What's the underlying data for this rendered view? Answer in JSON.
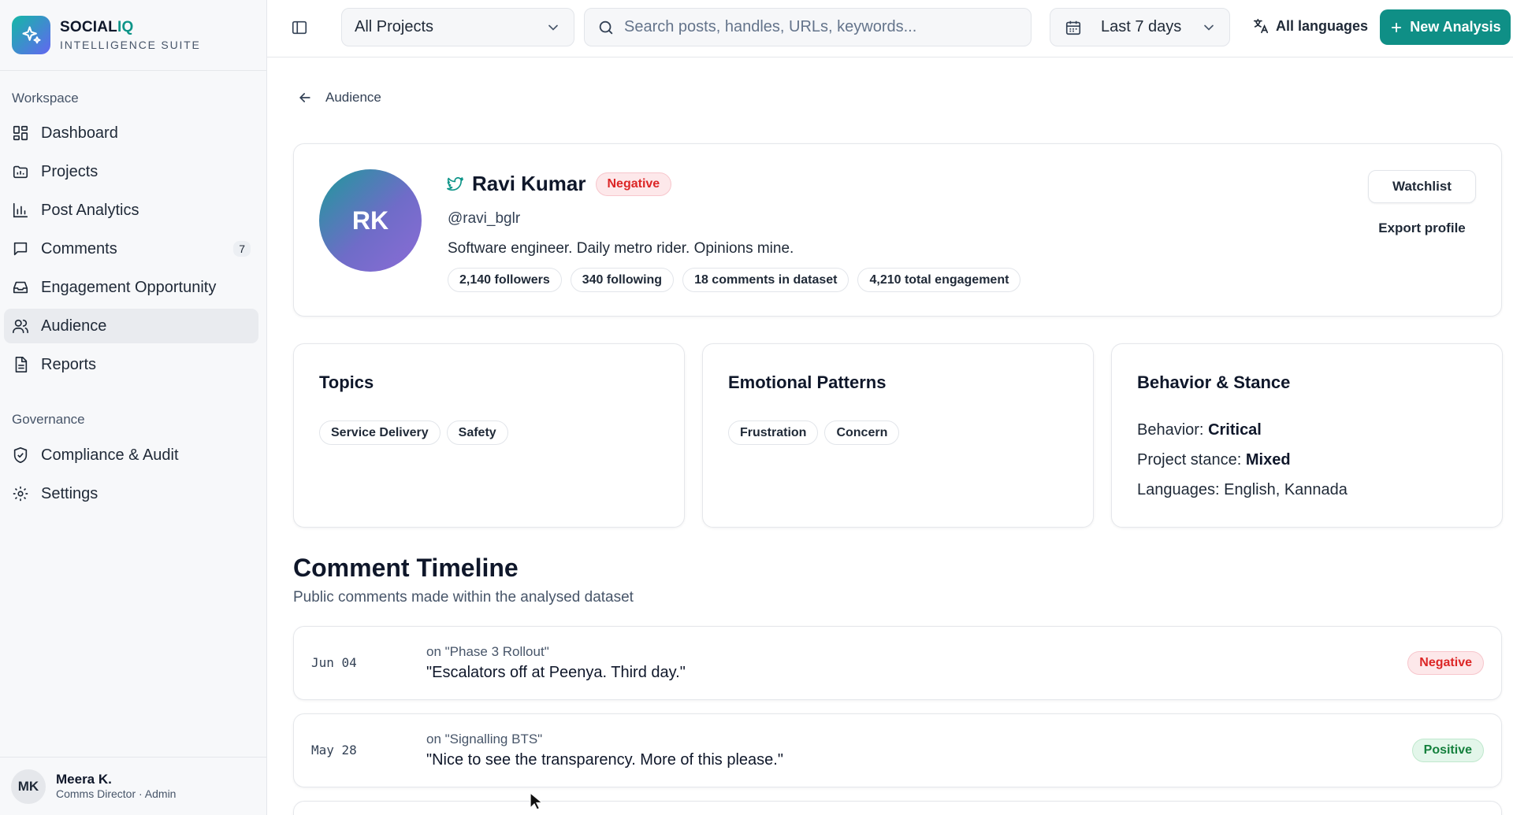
{
  "brand": {
    "name_part1": "SOCIAL",
    "name_part2": "IQ",
    "subtitle": "INTELLIGENCE SUITE"
  },
  "sidebar": {
    "workspace_heading": "Workspace",
    "workspace_items": [
      {
        "label": "Dashboard",
        "icon": "dashboard-icon"
      },
      {
        "label": "Projects",
        "icon": "folder-icon"
      },
      {
        "label": "Post Analytics",
        "icon": "bar-chart-icon"
      },
      {
        "label": "Comments",
        "icon": "comment-icon",
        "badge": "7"
      },
      {
        "label": "Engagement Opportunity",
        "icon": "inbox-icon"
      },
      {
        "label": "Audience",
        "icon": "users-icon",
        "active": true
      },
      {
        "label": "Reports",
        "icon": "report-icon"
      }
    ],
    "governance_heading": "Governance",
    "governance_items": [
      {
        "label": "Compliance & Audit",
        "icon": "shield-check-icon"
      },
      {
        "label": "Settings",
        "icon": "gear-icon"
      }
    ],
    "user": {
      "initials": "MK",
      "name": "Meera K.",
      "role": "Comms Director · Admin"
    }
  },
  "topbar": {
    "project_select": "All Projects",
    "search_placeholder": "Search posts, handles, URLs, keywords...",
    "date_range": "Last 7 days",
    "languages": "All languages",
    "new_analysis": "New Analysis"
  },
  "breadcrumb": {
    "label": "Audience"
  },
  "profile": {
    "initials": "RK",
    "name": "Ravi Kumar",
    "sentiment": "Negative",
    "handle": "@ravi_bglr",
    "bio": "Software engineer. Daily metro rider. Opinions mine.",
    "stats": [
      "2,140 followers",
      "340 following",
      "18 comments in dataset",
      "4,210 total engagement"
    ],
    "watchlist_label": "Watchlist",
    "export_label": "Export profile"
  },
  "topics": {
    "title": "Topics",
    "items": [
      "Service Delivery",
      "Safety"
    ]
  },
  "emotions": {
    "title": "Emotional Patterns",
    "items": [
      "Frustration",
      "Concern"
    ]
  },
  "behavior": {
    "title": "Behavior & Stance",
    "behavior_label": "Behavior:",
    "behavior_value": "Critical",
    "stance_label": "Project stance:",
    "stance_value": "Mixed",
    "languages_label": "Languages:",
    "languages_value": "English, Kannada"
  },
  "timeline": {
    "title": "Comment Timeline",
    "subtitle": "Public comments made within the analysed dataset",
    "items": [
      {
        "date": "Jun 04",
        "on": "on \"Phase 3 Rollout\"",
        "text": "\"Escalators off at Peenya. Third day.\"",
        "sentiment": "Negative"
      },
      {
        "date": "May 28",
        "on": "on \"Signalling BTS\"",
        "text": "\"Nice to see the transparency. More of this please.\"",
        "sentiment": "Positive"
      }
    ]
  },
  "colors": {
    "accent": "#0f8f86",
    "negative": "#dc2626",
    "positive": "#15803d"
  }
}
